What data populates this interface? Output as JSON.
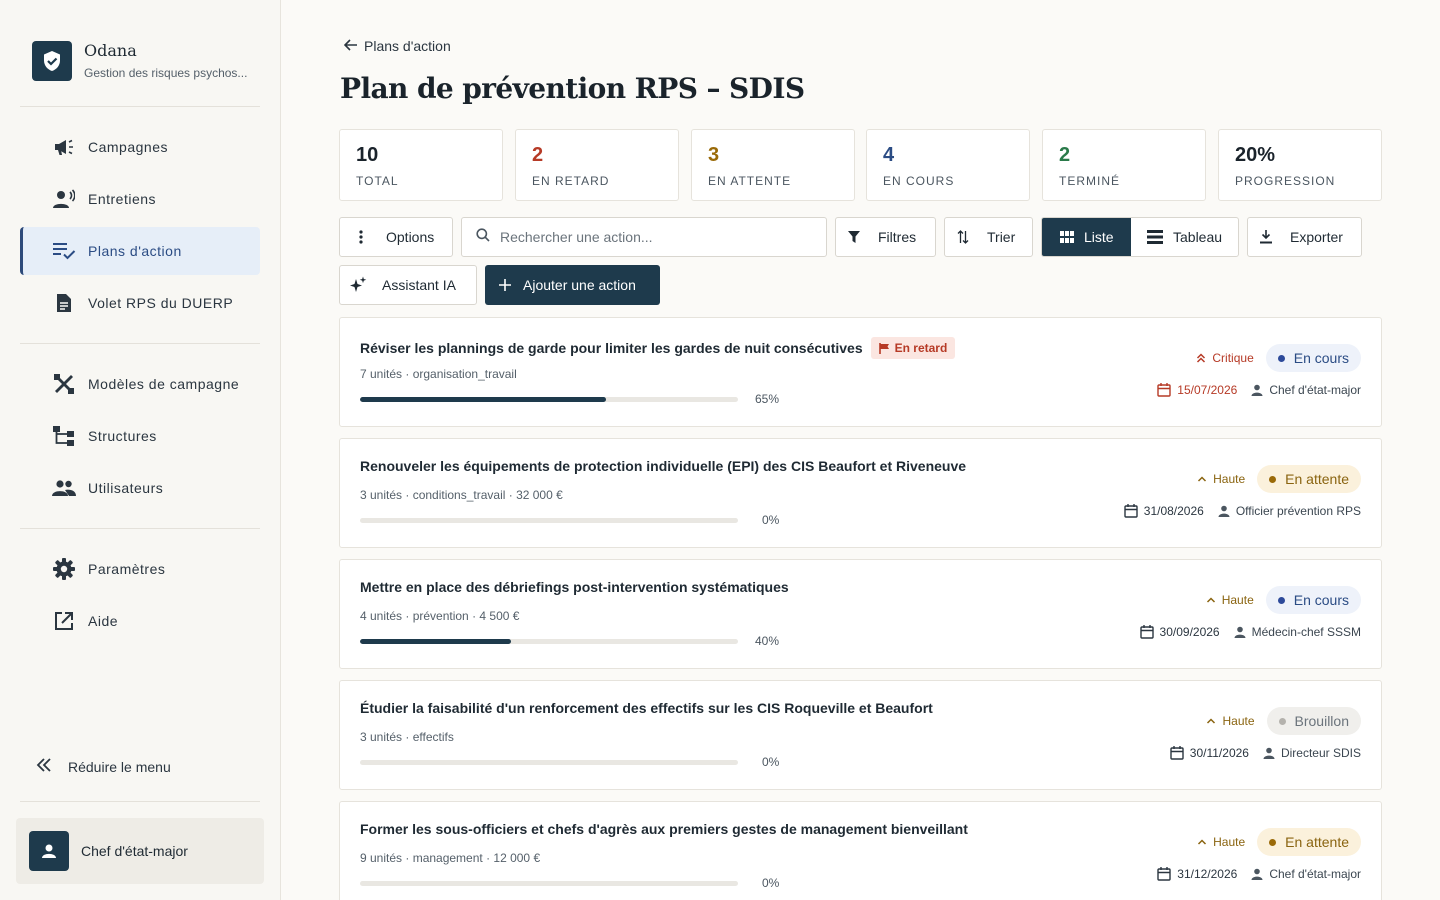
{
  "brand": {
    "name": "Odana",
    "subtitle": "Gestion des risques psychos..."
  },
  "nav": {
    "items": [
      {
        "label": "Campagnes",
        "icon": "megaphone-icon"
      },
      {
        "label": "Entretiens",
        "icon": "interview-icon"
      },
      {
        "label": "Plans d'action",
        "icon": "checklist-icon",
        "active": true
      },
      {
        "label": "Volet RPS du DUERP",
        "icon": "document-icon"
      },
      {
        "label": "Modèles de campagne",
        "icon": "tools-icon"
      },
      {
        "label": "Structures",
        "icon": "hierarchy-icon"
      },
      {
        "label": "Utilisateurs",
        "icon": "users-icon"
      },
      {
        "label": "Paramètres",
        "icon": "gear-icon"
      },
      {
        "label": "Aide",
        "icon": "external-link-icon"
      }
    ],
    "collapse_label": "Réduire le menu"
  },
  "user": {
    "name": "Chef d'état-major"
  },
  "breadcrumb": {
    "back_label": "Plans d'action"
  },
  "page": {
    "title": "Plan de prévention RPS – SDIS"
  },
  "stats": [
    {
      "value": "10",
      "label": "TOTAL",
      "color": "#1a232b"
    },
    {
      "value": "2",
      "label": "EN RETARD",
      "color": "#b63a26"
    },
    {
      "value": "3",
      "label": "EN ATTENTE",
      "color": "#9a6a08"
    },
    {
      "value": "4",
      "label": "EN COURS",
      "color": "#2b4c84"
    },
    {
      "value": "2",
      "label": "TERMINÉ",
      "color": "#2a7a4a"
    },
    {
      "value": "20%",
      "label": "PROGRESSION",
      "color": "#1a232b"
    }
  ],
  "toolbar": {
    "options_label": "Options",
    "search_placeholder": "Rechercher une action...",
    "filters_label": "Filtres",
    "sort_label": "Trier",
    "view_list_label": "Liste",
    "view_board_label": "Tableau",
    "export_label": "Exporter",
    "ai_label": "Assistant IA",
    "add_label": "Ajouter une action"
  },
  "actions": [
    {
      "title": "Réviser les plannings de garde pour limiter les gardes de nuit consécutives",
      "late_badge": "En retard",
      "meta": "7 unités · organisation_travail",
      "progress": 65,
      "progress_label": "65%",
      "priority": "Critique",
      "status": "En cours",
      "due_date": "15/07/2026",
      "owner": "Chef d'état-major"
    },
    {
      "title": "Renouveler les équipements de protection individuelle (EPI) des CIS Beaufort et Riveneuve",
      "meta": "3 unités · conditions_travail · 32 000 €",
      "progress": 0,
      "progress_label": "0%",
      "priority": "Haute",
      "status": "En attente",
      "due_date": "31/08/2026",
      "owner": "Officier prévention RPS"
    },
    {
      "title": "Mettre en place des débriefings post-intervention systématiques",
      "meta": "4 unités · prévention · 4 500 €",
      "progress": 40,
      "progress_label": "40%",
      "priority": "Haute",
      "status": "En cours",
      "due_date": "30/09/2026",
      "owner": "Médecin-chef SSSM"
    },
    {
      "title": "Étudier la faisabilité d'un renforcement des effectifs sur les CIS Roqueville et Beaufort",
      "meta": "3 unités · effectifs",
      "progress": 0,
      "progress_label": "0%",
      "priority": "Haute",
      "status": "Brouillon",
      "due_date": "30/11/2026",
      "owner": "Directeur SDIS"
    },
    {
      "title": "Former les sous-officiers et chefs d'agrès aux premiers gestes de management bienveillant",
      "meta": "9 unités · management · 12 000 €",
      "progress": 0,
      "progress_label": "0%",
      "priority": "Haute",
      "status": "En attente",
      "due_date": "31/12/2026",
      "owner": "Chef d'état-major"
    }
  ]
}
